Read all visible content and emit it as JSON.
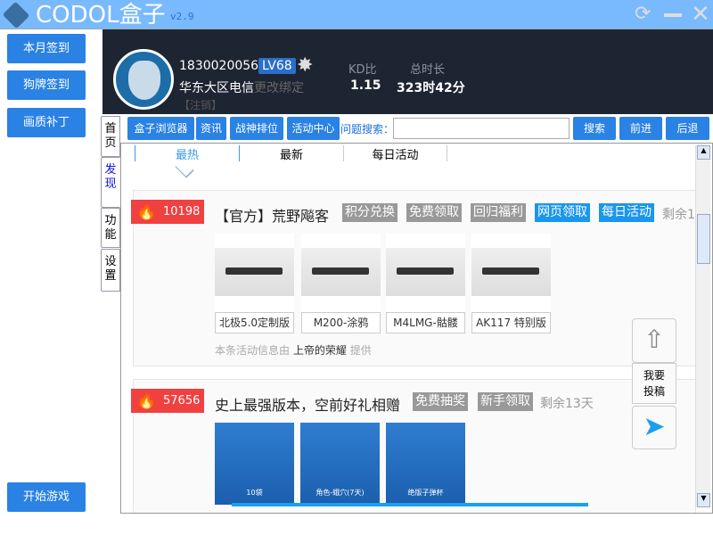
{
  "app": {
    "title": "CODOL盒子",
    "version": "v2.9"
  },
  "window_icons": [
    "refresh-icon",
    "minimize-icon",
    "close-icon"
  ],
  "left_buttons": [
    "本月签到",
    "狗牌签到",
    "画质补丁",
    "开始游戏"
  ],
  "user": {
    "id": "1830020056",
    "level": "LV68",
    "region": "华东大区电信",
    "rebind": "更改绑定",
    "logout": "【注销】",
    "kd_label": "KD比",
    "kd_value": "1.15",
    "time_label": "总时长",
    "time_value": "323时42分"
  },
  "vtabs": [
    "首页",
    "发现",
    "功能",
    "设置"
  ],
  "toolbar": {
    "buttons": [
      "盒子浏览器",
      "资讯",
      "战神排位",
      "活动中心"
    ],
    "search_label": "问题搜索：",
    "search_value": "",
    "search_btn": "搜索",
    "forward": "前进",
    "back": "后退"
  },
  "subtabs": [
    "最热",
    "最新",
    "每日活动"
  ],
  "cards": [
    {
      "count": "10198",
      "title": "【官方】荒野飚客",
      "tags": [
        "积分兑换",
        "免费领取",
        "回归福利",
        "网页领取",
        "每日活动"
      ],
      "remain": "剩余1",
      "items": [
        "北极5.0定制版",
        "M200-涂鸦",
        "M4LMG-骷髅",
        "AK117 特别版"
      ],
      "provider_prefix": "本条活动信息由",
      "provider": "上帝的荣耀",
      "provider_suffix": "提供"
    },
    {
      "count": "57656",
      "title": "史上最强版本，空前好礼相赠",
      "tags": [
        "免费抽奖",
        "新手领取"
      ],
      "remain": "剩余13天",
      "items": [
        "10袋",
        "角色-蛾穴(7天)",
        "绝版子弹杯"
      ]
    }
  ],
  "float": {
    "submit": [
      "我要",
      "投稿"
    ]
  },
  "colors": {
    "titlebar": "#79b9fd",
    "button": "#2a82e4",
    "header": "#1e2532",
    "badge": "#f04040",
    "tag_blue": "#1a96ee",
    "tag_gray": "#999999"
  }
}
